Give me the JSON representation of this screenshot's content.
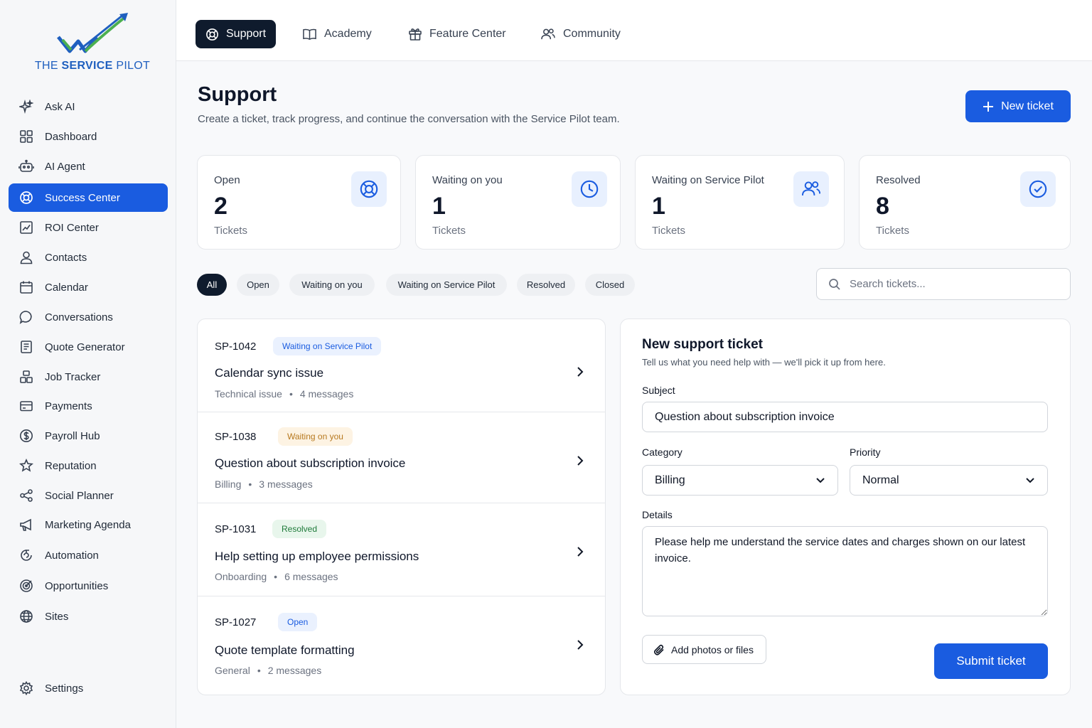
{
  "brand": {
    "name_part1": "THE ",
    "name_part2": "SERVICE",
    "name_part3": " PILOT",
    "color": "#1f5fbf",
    "accent_green": "#4caf50"
  },
  "sidebar": {
    "items": [
      {
        "label": "Ask AI",
        "icon": "sparkle-icon"
      },
      {
        "label": "Dashboard",
        "icon": "grid-icon"
      },
      {
        "label": "AI Agent",
        "icon": "robot-icon"
      },
      {
        "label": "Success Center",
        "icon": "lifebuoy-icon",
        "active": true
      },
      {
        "label": "ROI Center",
        "icon": "chart-icon"
      },
      {
        "label": "Contacts",
        "icon": "user-icon"
      },
      {
        "label": "Calendar",
        "icon": "calendar-icon"
      },
      {
        "label": "Conversations",
        "icon": "chat-icon"
      },
      {
        "label": "Quote Generator",
        "icon": "document-icon"
      },
      {
        "label": "Job Tracker",
        "icon": "boxes-icon"
      },
      {
        "label": "Payments",
        "icon": "card-icon"
      },
      {
        "label": "Payroll Hub",
        "icon": "dollar-icon"
      },
      {
        "label": "Reputation",
        "icon": "star-icon"
      },
      {
        "label": "Social Planner",
        "icon": "share-icon"
      },
      {
        "label": "Marketing Agenda",
        "icon": "megaphone-icon"
      },
      {
        "label": "Automation",
        "icon": "automation-icon"
      },
      {
        "label": "Opportunities",
        "icon": "target-icon"
      },
      {
        "label": "Sites",
        "icon": "globe-icon"
      }
    ],
    "settings_label": "Settings"
  },
  "tabs": [
    {
      "label": "Support",
      "icon": "lifebuoy-icon",
      "active": true
    },
    {
      "label": "Academy",
      "icon": "book-icon"
    },
    {
      "label": "Feature Center",
      "icon": "gift-icon"
    },
    {
      "label": "Community",
      "icon": "users-icon"
    }
  ],
  "header": {
    "title": "Support",
    "subtitle": "Create a ticket, track progress, and continue the conversation with the Service Pilot team.",
    "new_ticket_label": "New ticket"
  },
  "stats": [
    {
      "label": "Open",
      "value": "2",
      "unit": "Tickets",
      "icon": "lifebuoy-icon"
    },
    {
      "label": "Waiting on you",
      "value": "1",
      "unit": "Tickets",
      "icon": "clock-icon"
    },
    {
      "label": "Waiting on Service Pilot",
      "value": "1",
      "unit": "Tickets",
      "icon": "users-icon"
    },
    {
      "label": "Resolved",
      "value": "8",
      "unit": "Tickets",
      "icon": "check-circle-icon"
    }
  ],
  "filters": [
    "All",
    "Open",
    "Waiting on you",
    "Waiting on Service Pilot",
    "Resolved",
    "Closed"
  ],
  "search": {
    "placeholder": "Search tickets..."
  },
  "tickets": [
    {
      "id": "SP-1042",
      "status": "Waiting on Service Pilot",
      "title": "Calendar sync issue",
      "category": "Technical issue",
      "messages": "4 messages"
    },
    {
      "id": "SP-1038",
      "status": "Waiting on you",
      "title": "Question about subscription invoice",
      "category": "Billing",
      "messages": "3 messages"
    },
    {
      "id": "SP-1031",
      "status": "Resolved",
      "title": "Help setting up employee permissions",
      "category": "Onboarding",
      "messages": "6 messages"
    },
    {
      "id": "SP-1027",
      "status": "Open",
      "title": "Quote template formatting",
      "category": "General",
      "messages": "2 messages"
    }
  ],
  "status_colors": {
    "waiting_sp": {
      "bg": "#eaf1fe",
      "fg": "#1a5ce0"
    },
    "waiting_you": {
      "bg": "#fdf3e3",
      "fg": "#b7791f"
    },
    "resolved": {
      "bg": "#e8f6ec",
      "fg": "#1f7a3a"
    },
    "open": {
      "bg": "#eaf1fe",
      "fg": "#1a5ce0"
    }
  },
  "form": {
    "title": "New support ticket",
    "subtitle": "Tell us what you need help with — we'll pick it up from here.",
    "subject_label": "Subject",
    "subject_value": "Question about subscription invoice",
    "category_label": "Category",
    "category_value": "Billing",
    "priority_label": "Priority",
    "priority_value": "Normal",
    "details_label": "Details",
    "details_value": "Please help me understand the service dates and charges shown on our latest invoice.",
    "attach_label": "Add photos or files",
    "submit_label": "Submit ticket"
  },
  "colors": {
    "primary": "#1a5ce0",
    "dark": "#0f1b2d"
  }
}
